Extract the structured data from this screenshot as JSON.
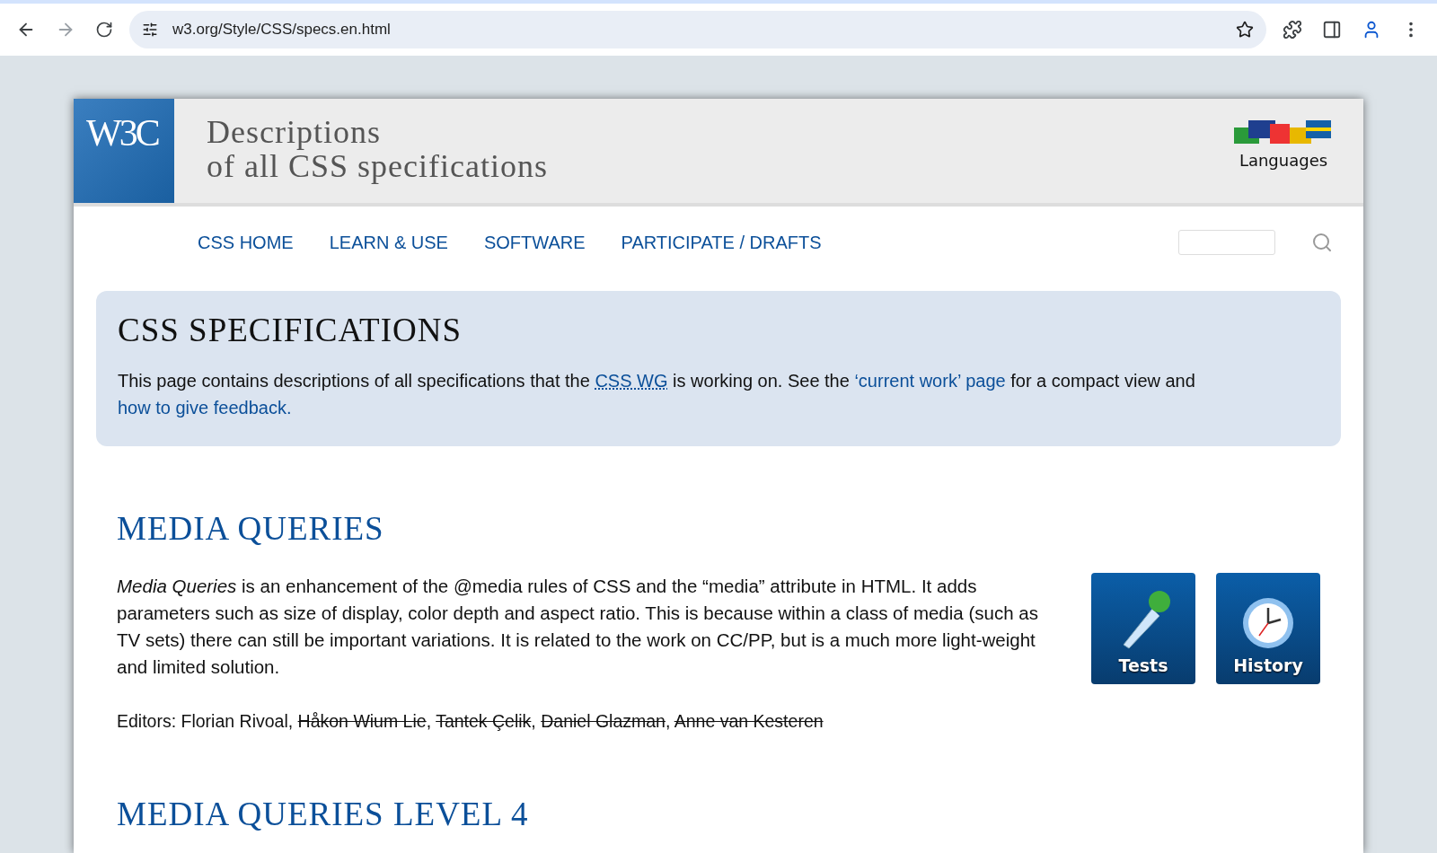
{
  "browser": {
    "url": "w3.org/Style/CSS/specs.en.html"
  },
  "header": {
    "logo": "W3C",
    "title_lines": [
      "Descriptions",
      "of all CSS specifications"
    ],
    "languages_label": "Languages"
  },
  "nav": {
    "items": [
      {
        "label": "CSS HOME"
      },
      {
        "label": "LEARN & USE"
      },
      {
        "label": "SOFTWARE"
      },
      {
        "label": "PARTICIPATE / DRAFTS"
      }
    ]
  },
  "intro": {
    "heading": "CSS SPECIFICATIONS",
    "parts": [
      {
        "kind": "text",
        "text": "This page contains descriptions of all specifications that the "
      },
      {
        "kind": "abbr",
        "text": "CSS WG"
      },
      {
        "kind": "text",
        "text": " is working on. See the "
      },
      {
        "kind": "link",
        "text": "‘current work’ page"
      },
      {
        "kind": "text",
        "text": " for a compact view and "
      },
      {
        "kind": "link",
        "text": "how to give feedback."
      }
    ]
  },
  "sections": [
    {
      "heading": "MEDIA QUERIES",
      "description": "*Media Queries* is an enhancement of the @media rules of CSS and the “media” attribute in HTML. It adds parameters such as size of display, color depth and aspect ratio. This is because within a class of media (such as TV sets) there can still be important variations. It is related to the work on CC/PP, but is a much more light-weight and limited solution.",
      "editors_label": "Editors:",
      "editors_separator": ", ",
      "editors": [
        {
          "name": "Florian Rivoal",
          "struck": false
        },
        {
          "name": "Håkon Wium Lie",
          "struck": true
        },
        {
          "name": "Tantek Çelik",
          "struck": true
        },
        {
          "name": "Daniel Glazman",
          "struck": true
        },
        {
          "name": "Anne van Kesteren",
          "struck": true
        }
      ],
      "buttons": [
        {
          "kind": "tests",
          "label": "Tests"
        },
        {
          "kind": "history",
          "label": "History"
        }
      ]
    },
    {
      "heading": "MEDIA QUERIES LEVEL 4"
    }
  ]
}
